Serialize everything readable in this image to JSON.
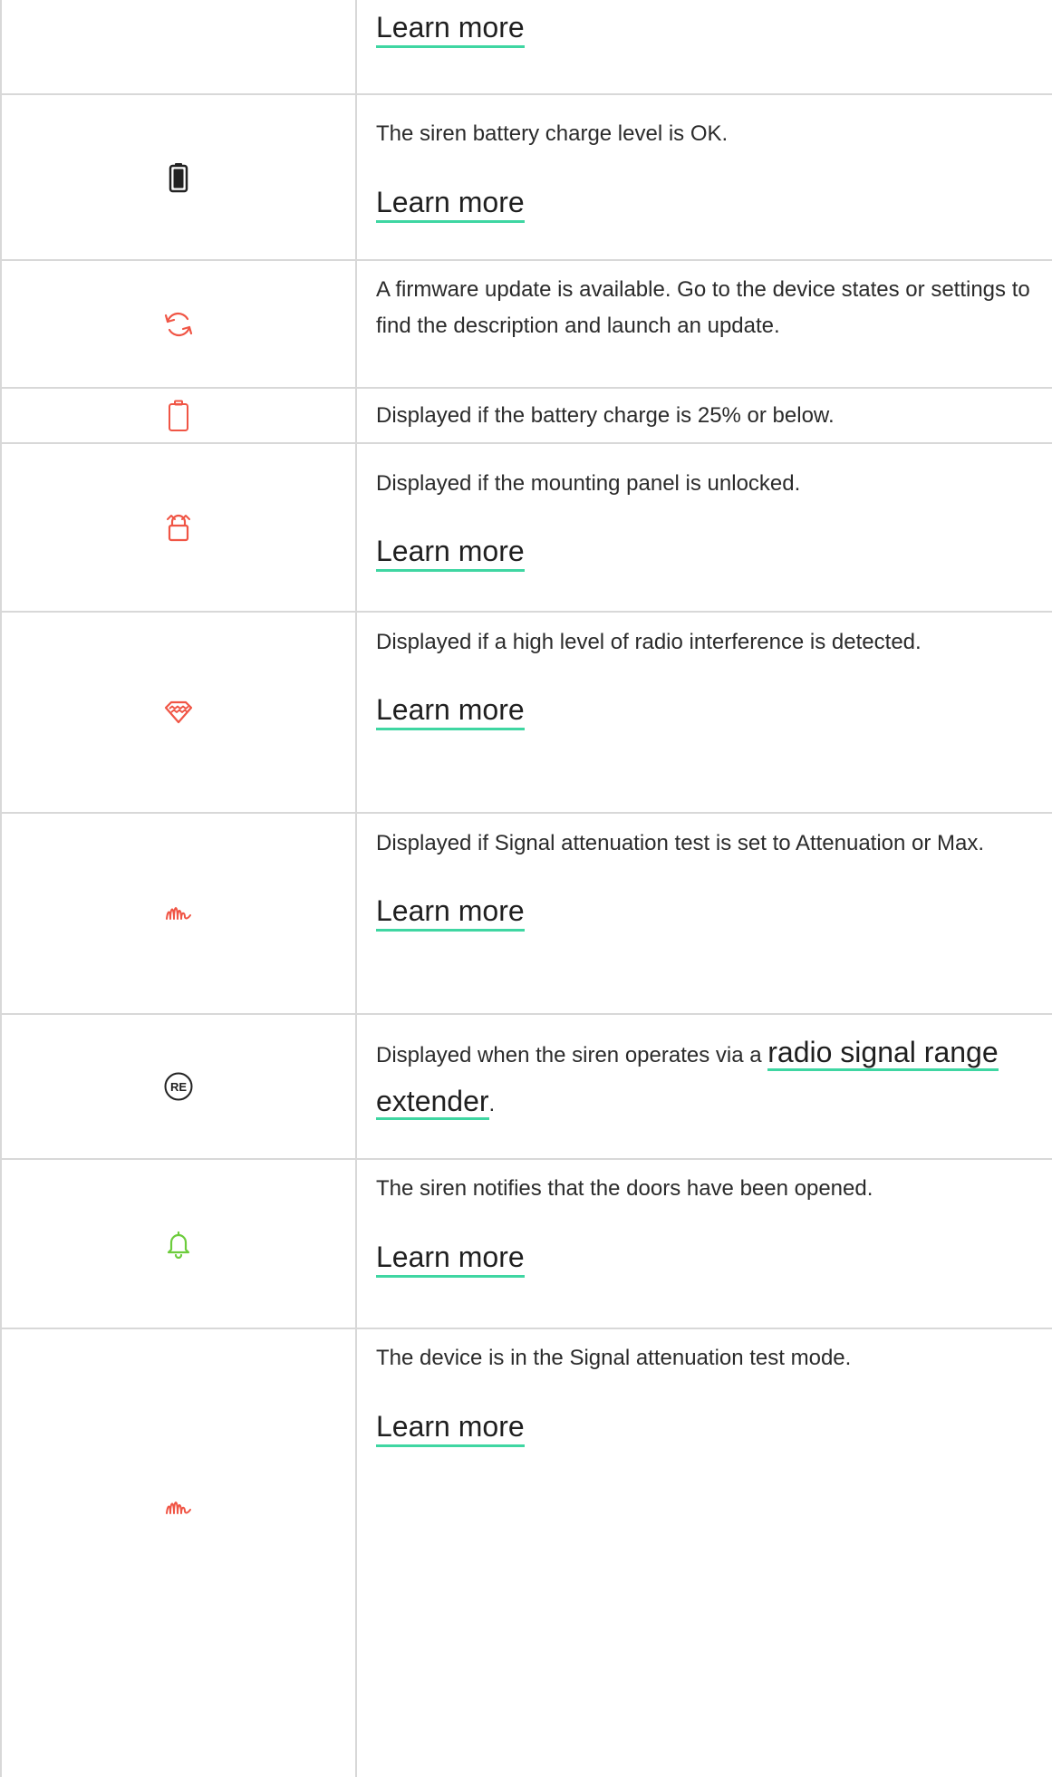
{
  "colors": {
    "alert": "#f05545",
    "ok": "#222222",
    "green": "#6ccc3c",
    "link_underline": "#3fd6a2",
    "border": "#d8d8d8"
  },
  "rows": [
    {
      "icon": "none",
      "link": "Learn more"
    },
    {
      "icon": "battery-full-icon",
      "text": "The siren battery charge level is OK.",
      "link": "Learn more"
    },
    {
      "icon": "firmware-update-icon",
      "text": "A firmware update is available. Go to the device states or settings to find the description and launch an update."
    },
    {
      "icon": "battery-low-icon",
      "text": "Displayed if the battery charge is 25% or below."
    },
    {
      "icon": "unlocked-panel-icon",
      "text": "Displayed if the mounting panel is unlocked.",
      "link": "Learn more"
    },
    {
      "icon": "interference-icon",
      "text": "Displayed if a high level of radio interference is detected.",
      "link": "Learn more"
    },
    {
      "icon": "attenuation-wave-icon",
      "text": "Displayed if Signal attenuation test is set to Attenuation or Max.",
      "link": "Learn more"
    },
    {
      "icon": "range-extender-icon",
      "icon_label": "RE",
      "text_before": "Displayed when the siren operates via a ",
      "link": "radio signal range extender",
      "text_after": "."
    },
    {
      "icon": "door-bell-icon",
      "text": "The siren notifies that the doors have been opened.",
      "link": "Learn more"
    },
    {
      "icon": "attenuation-wave-icon",
      "text": "The device is in the Signal attenuation test mode.",
      "link": "Learn more"
    }
  ]
}
